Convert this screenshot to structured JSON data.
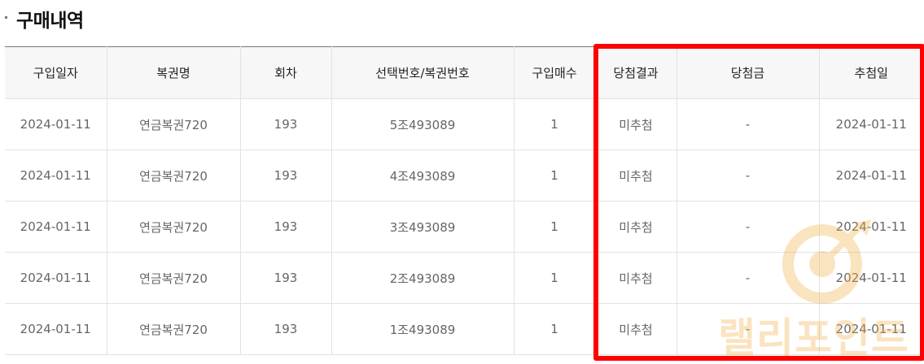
{
  "page": {
    "title": "구매내역"
  },
  "table": {
    "headers": [
      "구입일자",
      "복권명",
      "회차",
      "선택번호/복권번호",
      "구입매수",
      "당첨결과",
      "당첨금",
      "추첨일"
    ],
    "rows": [
      [
        "2024-01-11",
        "연금복권720",
        "193",
        "5조493089",
        "1",
        "미추첨",
        "-",
        "2024-01-11"
      ],
      [
        "2024-01-11",
        "연금복권720",
        "193",
        "4조493089",
        "1",
        "미추첨",
        "-",
        "2024-01-11"
      ],
      [
        "2024-01-11",
        "연금복권720",
        "193",
        "3조493089",
        "1",
        "미추첨",
        "-",
        "2024-01-11"
      ],
      [
        "2024-01-11",
        "연금복권720",
        "193",
        "2조493089",
        "1",
        "미추첨",
        "-",
        "2024-01-11"
      ],
      [
        "2024-01-11",
        "연금복권720",
        "193",
        "1조493089",
        "1",
        "미추첨",
        "-",
        "2024-01-11"
      ]
    ]
  },
  "watermark": {
    "text": "랠리포인트"
  },
  "colors": {
    "highlight": "#ff0000",
    "header_bg": "#f7f7f7",
    "watermark": "#f2b24a"
  }
}
